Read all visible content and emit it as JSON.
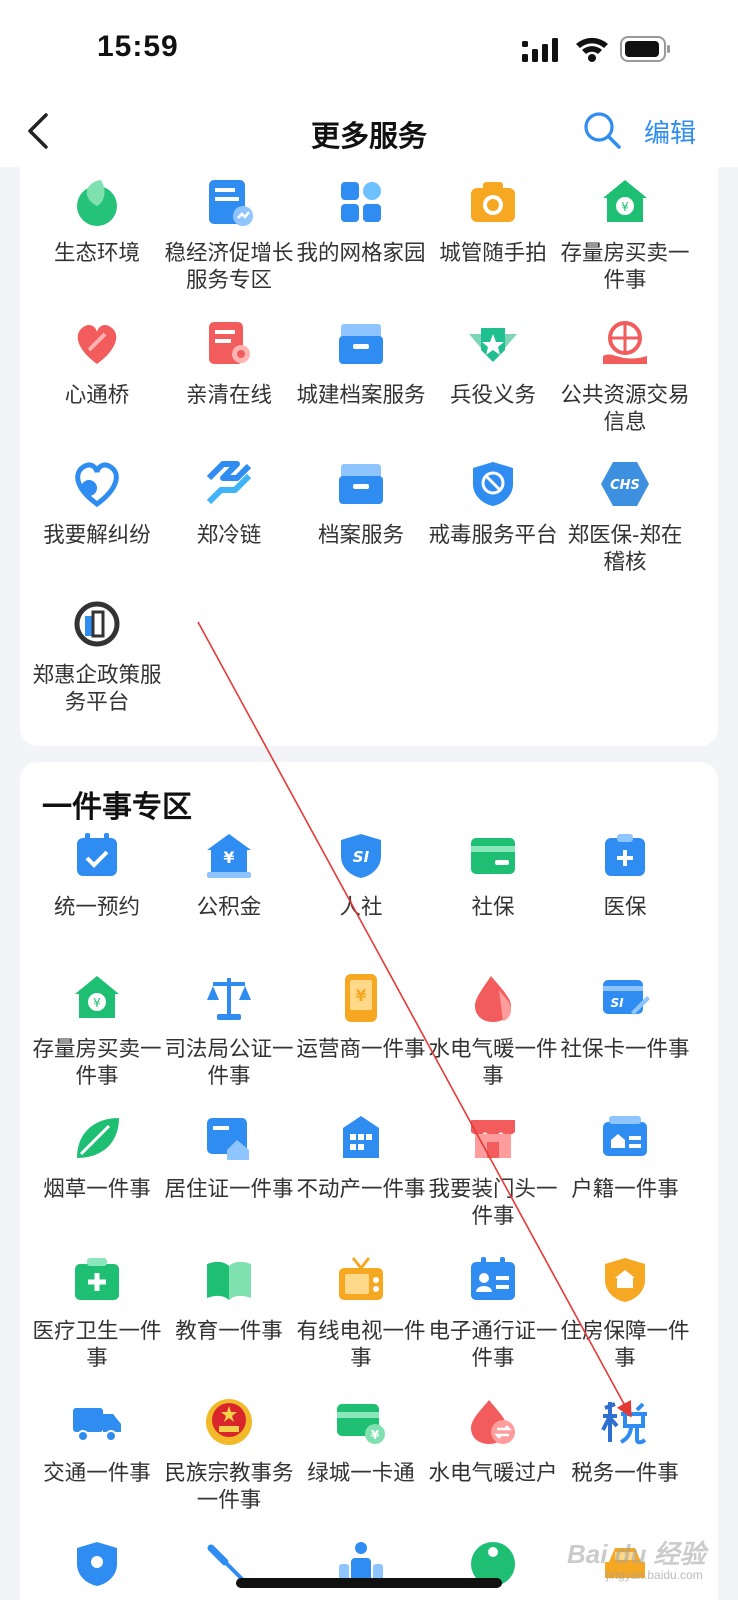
{
  "status_bar": {
    "time": "15:59"
  },
  "nav": {
    "title": "更多服务",
    "edit_label": "编辑"
  },
  "section1": {
    "items": [
      {
        "label": "生态环境"
      },
      {
        "label": "稳经济促增长服务专区"
      },
      {
        "label": "我的网格家园"
      },
      {
        "label": "城管随手拍"
      },
      {
        "label": "存量房买卖一件事"
      },
      {
        "label": "心通桥"
      },
      {
        "label": "亲清在线"
      },
      {
        "label": "城建档案服务"
      },
      {
        "label": "兵役义务"
      },
      {
        "label": "公共资源交易信息"
      },
      {
        "label": "我要解纠纷"
      },
      {
        "label": "郑冷链"
      },
      {
        "label": "档案服务"
      },
      {
        "label": "戒毒服务平台"
      },
      {
        "label": "郑医保-郑在稽核"
      },
      {
        "label": "郑惠企政策服务平台"
      }
    ]
  },
  "section2": {
    "title": "一件事专区",
    "items": [
      {
        "label": "统一预约"
      },
      {
        "label": "公积金"
      },
      {
        "label": "人社"
      },
      {
        "label": "社保"
      },
      {
        "label": "医保"
      },
      {
        "label": "存量房买卖一件事"
      },
      {
        "label": "司法局公证一件事"
      },
      {
        "label": "运营商一件事"
      },
      {
        "label": "水电气暖一件事"
      },
      {
        "label": "社保卡一件事"
      },
      {
        "label": "烟草一件事"
      },
      {
        "label": "居住证一件事"
      },
      {
        "label": "不动产一件事"
      },
      {
        "label": "我要装门头一件事"
      },
      {
        "label": "户籍一件事"
      },
      {
        "label": "医疗卫生一件事"
      },
      {
        "label": "教育一件事"
      },
      {
        "label": "有线电视一件事"
      },
      {
        "label": "电子通行证一件事"
      },
      {
        "label": "住房保障一件事"
      },
      {
        "label": "交通一件事"
      },
      {
        "label": "民族宗教事务一件事"
      },
      {
        "label": "绿城一卡通"
      },
      {
        "label": "水电气暖过户"
      },
      {
        "label": "税务一件事"
      }
    ]
  },
  "watermark": {
    "text": "Bai du 经验",
    "sub": "jingyan.baidu.com"
  },
  "colors": {
    "accent": "#2f8cf0",
    "annotation": "#e53935"
  }
}
